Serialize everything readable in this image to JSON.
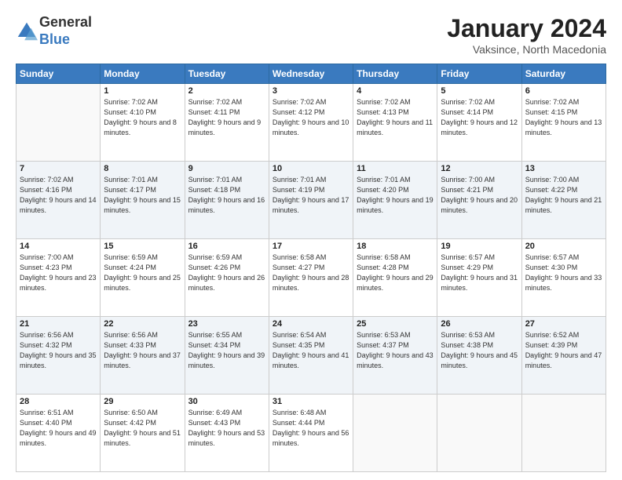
{
  "header": {
    "logo_general": "General",
    "logo_blue": "Blue",
    "title": "January 2024",
    "subtitle": "Vaksince, North Macedonia"
  },
  "days_of_week": [
    "Sunday",
    "Monday",
    "Tuesday",
    "Wednesday",
    "Thursday",
    "Friday",
    "Saturday"
  ],
  "weeks": [
    [
      {
        "day": "",
        "sunrise": "",
        "sunset": "",
        "daylight": ""
      },
      {
        "day": "1",
        "sunrise": "Sunrise: 7:02 AM",
        "sunset": "Sunset: 4:10 PM",
        "daylight": "Daylight: 9 hours and 8 minutes."
      },
      {
        "day": "2",
        "sunrise": "Sunrise: 7:02 AM",
        "sunset": "Sunset: 4:11 PM",
        "daylight": "Daylight: 9 hours and 9 minutes."
      },
      {
        "day": "3",
        "sunrise": "Sunrise: 7:02 AM",
        "sunset": "Sunset: 4:12 PM",
        "daylight": "Daylight: 9 hours and 10 minutes."
      },
      {
        "day": "4",
        "sunrise": "Sunrise: 7:02 AM",
        "sunset": "Sunset: 4:13 PM",
        "daylight": "Daylight: 9 hours and 11 minutes."
      },
      {
        "day": "5",
        "sunrise": "Sunrise: 7:02 AM",
        "sunset": "Sunset: 4:14 PM",
        "daylight": "Daylight: 9 hours and 12 minutes."
      },
      {
        "day": "6",
        "sunrise": "Sunrise: 7:02 AM",
        "sunset": "Sunset: 4:15 PM",
        "daylight": "Daylight: 9 hours and 13 minutes."
      }
    ],
    [
      {
        "day": "7",
        "sunrise": "Sunrise: 7:02 AM",
        "sunset": "Sunset: 4:16 PM",
        "daylight": "Daylight: 9 hours and 14 minutes."
      },
      {
        "day": "8",
        "sunrise": "Sunrise: 7:01 AM",
        "sunset": "Sunset: 4:17 PM",
        "daylight": "Daylight: 9 hours and 15 minutes."
      },
      {
        "day": "9",
        "sunrise": "Sunrise: 7:01 AM",
        "sunset": "Sunset: 4:18 PM",
        "daylight": "Daylight: 9 hours and 16 minutes."
      },
      {
        "day": "10",
        "sunrise": "Sunrise: 7:01 AM",
        "sunset": "Sunset: 4:19 PM",
        "daylight": "Daylight: 9 hours and 17 minutes."
      },
      {
        "day": "11",
        "sunrise": "Sunrise: 7:01 AM",
        "sunset": "Sunset: 4:20 PM",
        "daylight": "Daylight: 9 hours and 19 minutes."
      },
      {
        "day": "12",
        "sunrise": "Sunrise: 7:00 AM",
        "sunset": "Sunset: 4:21 PM",
        "daylight": "Daylight: 9 hours and 20 minutes."
      },
      {
        "day": "13",
        "sunrise": "Sunrise: 7:00 AM",
        "sunset": "Sunset: 4:22 PM",
        "daylight": "Daylight: 9 hours and 21 minutes."
      }
    ],
    [
      {
        "day": "14",
        "sunrise": "Sunrise: 7:00 AM",
        "sunset": "Sunset: 4:23 PM",
        "daylight": "Daylight: 9 hours and 23 minutes."
      },
      {
        "day": "15",
        "sunrise": "Sunrise: 6:59 AM",
        "sunset": "Sunset: 4:24 PM",
        "daylight": "Daylight: 9 hours and 25 minutes."
      },
      {
        "day": "16",
        "sunrise": "Sunrise: 6:59 AM",
        "sunset": "Sunset: 4:26 PM",
        "daylight": "Daylight: 9 hours and 26 minutes."
      },
      {
        "day": "17",
        "sunrise": "Sunrise: 6:58 AM",
        "sunset": "Sunset: 4:27 PM",
        "daylight": "Daylight: 9 hours and 28 minutes."
      },
      {
        "day": "18",
        "sunrise": "Sunrise: 6:58 AM",
        "sunset": "Sunset: 4:28 PM",
        "daylight": "Daylight: 9 hours and 29 minutes."
      },
      {
        "day": "19",
        "sunrise": "Sunrise: 6:57 AM",
        "sunset": "Sunset: 4:29 PM",
        "daylight": "Daylight: 9 hours and 31 minutes."
      },
      {
        "day": "20",
        "sunrise": "Sunrise: 6:57 AM",
        "sunset": "Sunset: 4:30 PM",
        "daylight": "Daylight: 9 hours and 33 minutes."
      }
    ],
    [
      {
        "day": "21",
        "sunrise": "Sunrise: 6:56 AM",
        "sunset": "Sunset: 4:32 PM",
        "daylight": "Daylight: 9 hours and 35 minutes."
      },
      {
        "day": "22",
        "sunrise": "Sunrise: 6:56 AM",
        "sunset": "Sunset: 4:33 PM",
        "daylight": "Daylight: 9 hours and 37 minutes."
      },
      {
        "day": "23",
        "sunrise": "Sunrise: 6:55 AM",
        "sunset": "Sunset: 4:34 PM",
        "daylight": "Daylight: 9 hours and 39 minutes."
      },
      {
        "day": "24",
        "sunrise": "Sunrise: 6:54 AM",
        "sunset": "Sunset: 4:35 PM",
        "daylight": "Daylight: 9 hours and 41 minutes."
      },
      {
        "day": "25",
        "sunrise": "Sunrise: 6:53 AM",
        "sunset": "Sunset: 4:37 PM",
        "daylight": "Daylight: 9 hours and 43 minutes."
      },
      {
        "day": "26",
        "sunrise": "Sunrise: 6:53 AM",
        "sunset": "Sunset: 4:38 PM",
        "daylight": "Daylight: 9 hours and 45 minutes."
      },
      {
        "day": "27",
        "sunrise": "Sunrise: 6:52 AM",
        "sunset": "Sunset: 4:39 PM",
        "daylight": "Daylight: 9 hours and 47 minutes."
      }
    ],
    [
      {
        "day": "28",
        "sunrise": "Sunrise: 6:51 AM",
        "sunset": "Sunset: 4:40 PM",
        "daylight": "Daylight: 9 hours and 49 minutes."
      },
      {
        "day": "29",
        "sunrise": "Sunrise: 6:50 AM",
        "sunset": "Sunset: 4:42 PM",
        "daylight": "Daylight: 9 hours and 51 minutes."
      },
      {
        "day": "30",
        "sunrise": "Sunrise: 6:49 AM",
        "sunset": "Sunset: 4:43 PM",
        "daylight": "Daylight: 9 hours and 53 minutes."
      },
      {
        "day": "31",
        "sunrise": "Sunrise: 6:48 AM",
        "sunset": "Sunset: 4:44 PM",
        "daylight": "Daylight: 9 hours and 56 minutes."
      },
      {
        "day": "",
        "sunrise": "",
        "sunset": "",
        "daylight": ""
      },
      {
        "day": "",
        "sunrise": "",
        "sunset": "",
        "daylight": ""
      },
      {
        "day": "",
        "sunrise": "",
        "sunset": "",
        "daylight": ""
      }
    ]
  ]
}
